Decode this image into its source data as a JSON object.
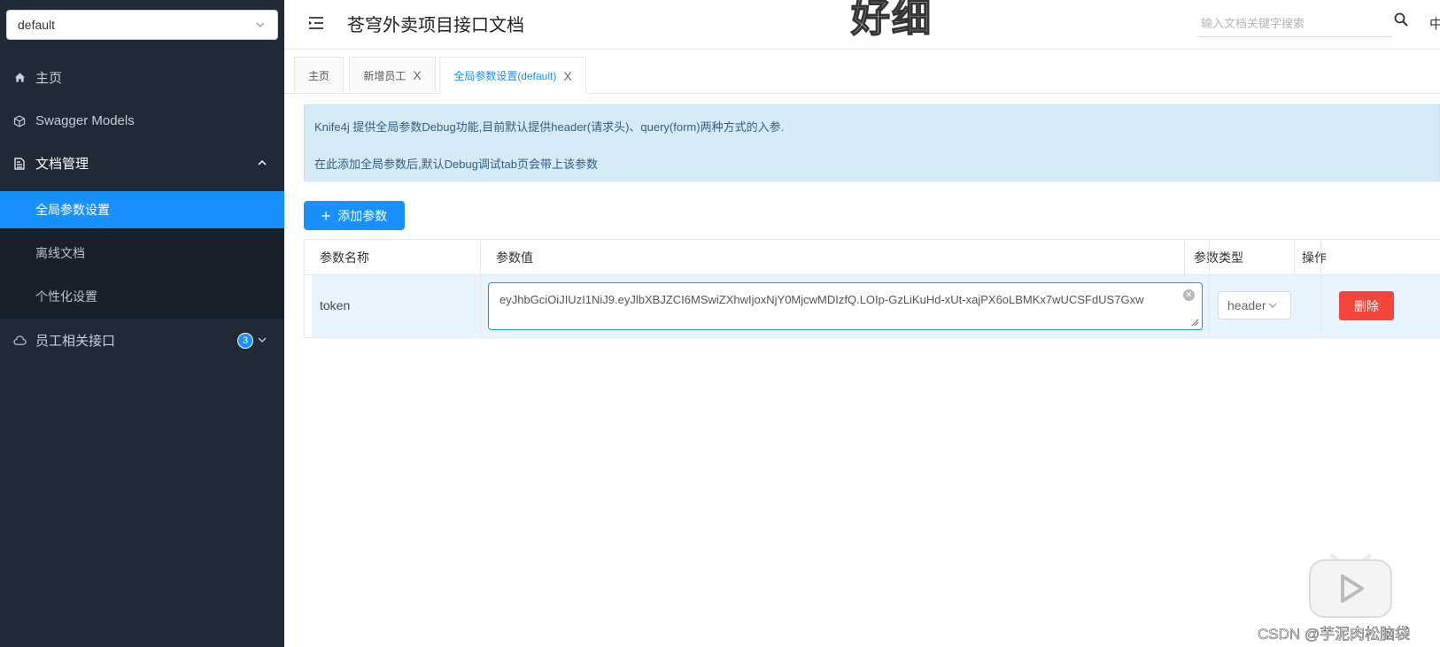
{
  "sidebar": {
    "group_select": "default",
    "items": [
      {
        "label": "主页",
        "icon": "home-icon"
      },
      {
        "label": "Swagger Models",
        "icon": "cube-icon"
      },
      {
        "label": "文档管理",
        "icon": "document-icon",
        "expanded": true,
        "children": [
          {
            "label": "全局参数设置",
            "active": true
          },
          {
            "label": "离线文档"
          },
          {
            "label": "个性化设置"
          }
        ]
      },
      {
        "label": "员工相关接口",
        "icon": "cloud-icon",
        "badge": "3"
      }
    ]
  },
  "header": {
    "title": "苍穹外卖项目接口文档",
    "overlay_text": "好细",
    "search_placeholder": "输入文档关键字搜索",
    "lang": "中"
  },
  "tabs": [
    {
      "label": "主页",
      "closable": false
    },
    {
      "label": "新增员工",
      "closable": true,
      "close": "X"
    },
    {
      "label": "全局参数设置(default)",
      "closable": true,
      "close": "X",
      "active": true
    }
  ],
  "info": {
    "line1": "Knife4j 提供全局参数Debug功能,目前默认提供header(请求头)、query(form)两种方式的入参.",
    "line2": "在此添加全局参数后,默认Debug调试tab页会带上该参数"
  },
  "add_button": {
    "label": "添加参数"
  },
  "table": {
    "columns": [
      "参数名称",
      "参数值",
      "参数类型",
      "操作"
    ],
    "rows": [
      {
        "name": "token",
        "value": "eyJhbGciOiJIUzI1NiJ9.eyJlbXBJZCI6MSwiZXhwIjoxNjY0MjcwMDIzfQ.LOIp-GzLiKuHd-xUt-xajPX6oLBMKx7wUCSFdUS7Gxw",
        "type": "header",
        "action": "删除"
      }
    ]
  },
  "watermark": "CSDN @芋泥肉松脑袋",
  "colors": {
    "primary": "#1890ff",
    "sidebar": "#1f2a36",
    "danger": "#f5453c",
    "info_bg": "#d7eaf8"
  }
}
